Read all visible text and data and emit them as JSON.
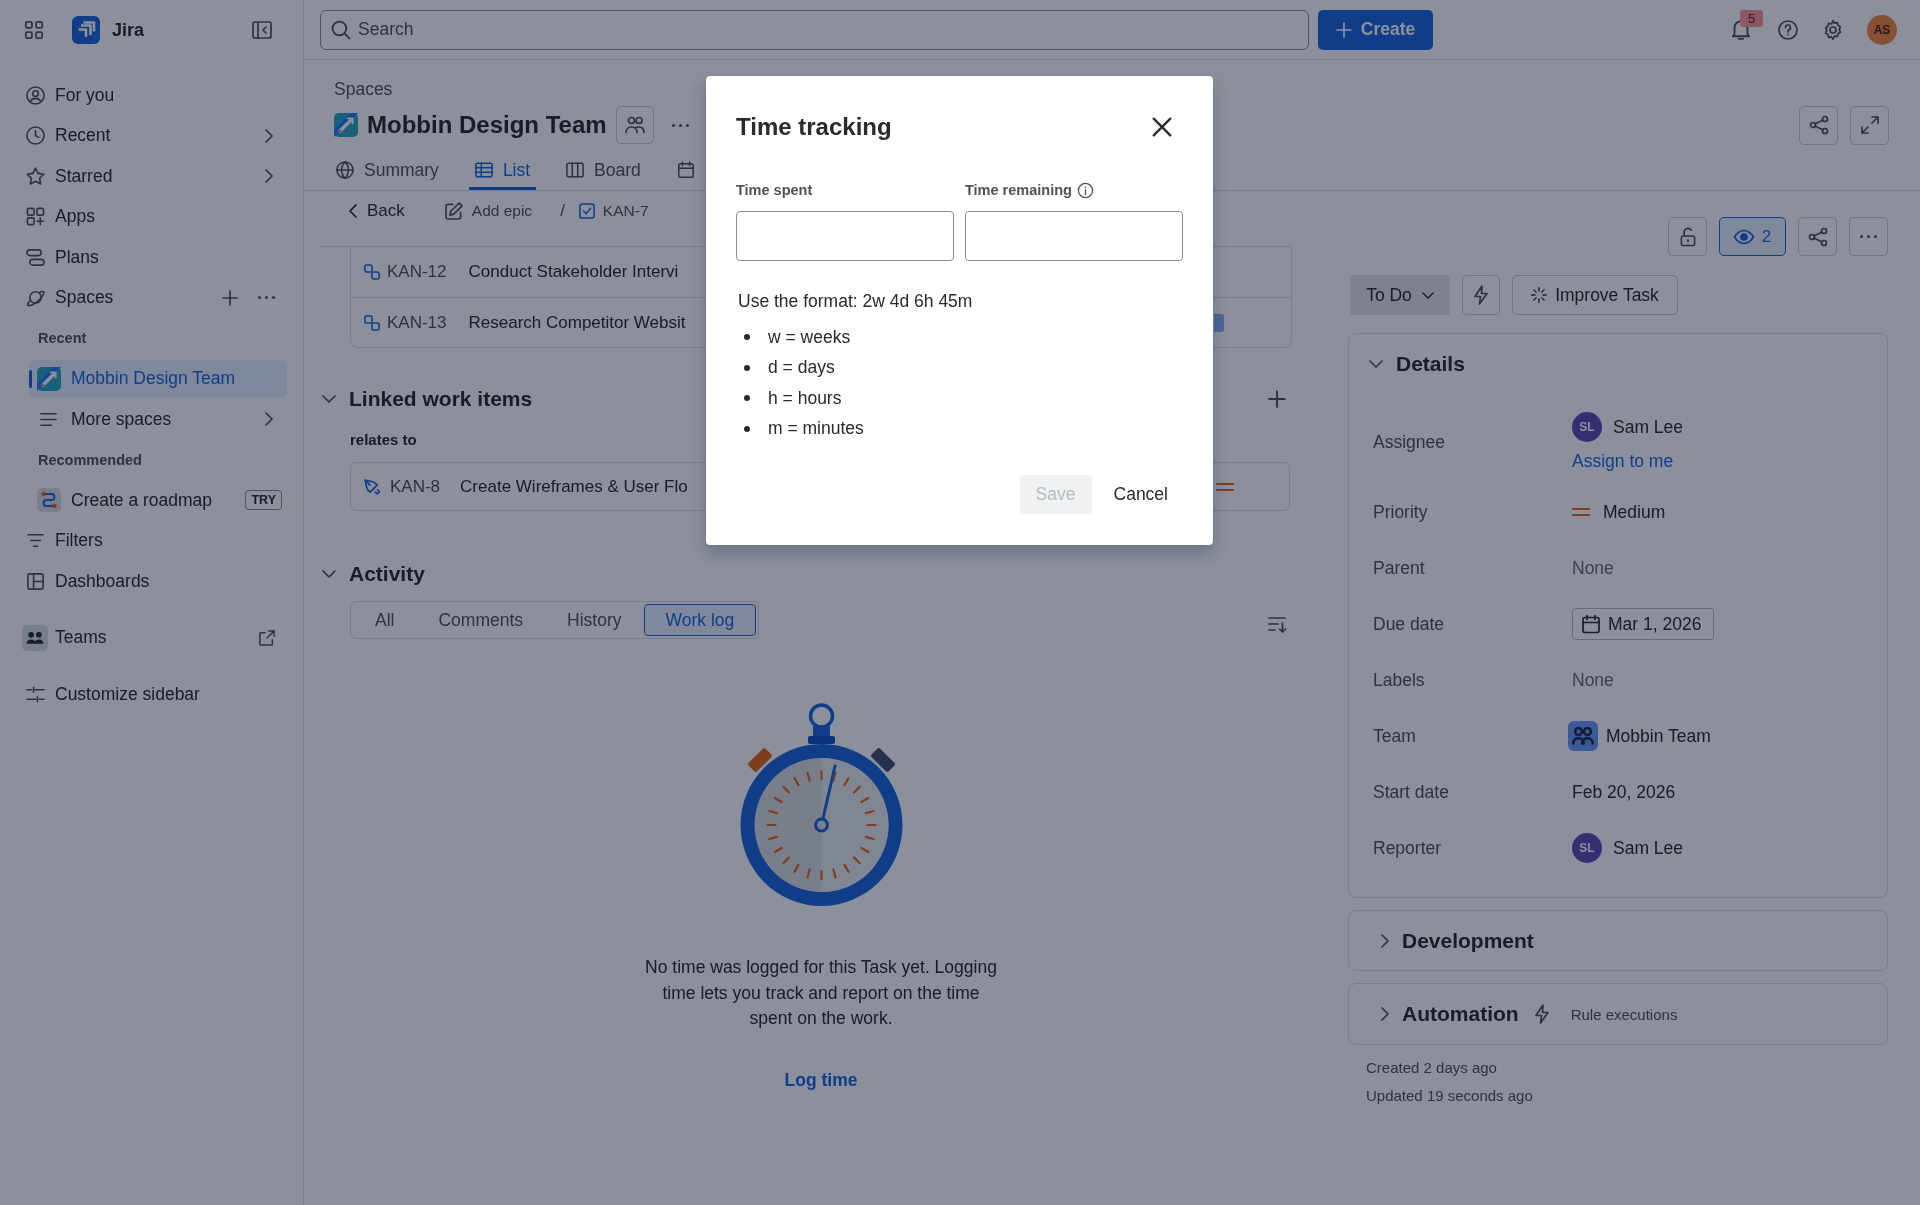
{
  "sidebar": {
    "app_name": "Jira",
    "items": [
      {
        "kind": "nav",
        "label": "For you",
        "selected": false,
        "chevron": false
      },
      {
        "kind": "nav",
        "label": "Recent",
        "selected": false,
        "chevron": true
      },
      {
        "kind": "nav",
        "label": "Starred",
        "selected": false,
        "chevron": true
      },
      {
        "kind": "nav",
        "label": "Apps",
        "selected": false,
        "chevron": false
      },
      {
        "kind": "nav",
        "label": "Plans",
        "selected": false,
        "chevron": false
      },
      {
        "kind": "section",
        "label": "Spaces",
        "selected": false,
        "chevron": false
      },
      {
        "kind": "heading",
        "label": "Recent"
      },
      {
        "kind": "space",
        "label": "Mobbin Design Team",
        "selected": true,
        "chevron": false
      },
      {
        "kind": "sub",
        "label": "More spaces",
        "selected": false,
        "chevron": true
      },
      {
        "kind": "heading",
        "label": "Recommended"
      },
      {
        "kind": "promo",
        "label": "Create a roadmap",
        "badge": "TRY",
        "selected": false,
        "chevron": false
      },
      {
        "kind": "nav",
        "label": "Filters",
        "selected": false,
        "chevron": false
      },
      {
        "kind": "nav",
        "label": "Dashboards",
        "selected": false,
        "chevron": false
      },
      {
        "kind": "external",
        "label": "Teams",
        "selected": false,
        "chevron": false
      },
      {
        "kind": "footer",
        "label": "Customize sidebar",
        "selected": false,
        "chevron": false
      }
    ]
  },
  "top_bar": {
    "search": {
      "placeholder": "Search"
    },
    "create_label": "Create",
    "notification_count": "5",
    "avatar_initials": "AS"
  },
  "space_header": {
    "breadcrumb": "Spaces",
    "title": "Mobbin Design Team",
    "tabs": [
      {
        "label": "Summary",
        "selected": false
      },
      {
        "label": "List",
        "selected": true
      },
      {
        "label": "Board",
        "selected": false
      },
      {
        "selected": false
      }
    ]
  },
  "work_item": {
    "toolbar": {
      "back": "Back",
      "add_epic": "Add epic",
      "separator": "/",
      "key": "KAN-7"
    },
    "child_items": [
      {
        "key": "KAN-12",
        "summary": "Conduct Stakeholder Intervi",
        "status_shown": false
      },
      {
        "key": "KAN-13",
        "summary": "Research Competitor Websit",
        "status_shown": true
      }
    ],
    "linked": {
      "title": "Linked work items",
      "expanded": true,
      "relation": "relates to",
      "items": [
        {
          "key": "KAN-8",
          "summary": "Create Wireframes & User Flo"
        }
      ]
    },
    "activity": {
      "title": "Activity",
      "expanded": true,
      "tabs": [
        {
          "label": "All",
          "selected": false
        },
        {
          "label": "Comments",
          "selected": false
        },
        {
          "label": "History",
          "selected": false
        },
        {
          "label": "Work log",
          "selected": true
        }
      ],
      "empty_message": "No time was logged for this Task yet. Logging time lets you track and report on the time spent on the work.",
      "action": "Log time"
    }
  },
  "right_panel": {
    "watchers": {
      "count": "2",
      "watching": true
    },
    "status": "To Do",
    "improve_label": "Improve Task",
    "details": {
      "title": "Details",
      "expanded": true,
      "fields": [
        {
          "label": "Assignee",
          "kind": "person",
          "initials": "SL",
          "value": "Sam Lee",
          "link": "Assign to me"
        },
        {
          "label": "Priority",
          "kind": "priority",
          "value": "Medium"
        },
        {
          "label": "Parent",
          "kind": "empty",
          "value": "None"
        },
        {
          "label": "Due date",
          "kind": "date",
          "value": "Mar 1, 2026"
        },
        {
          "label": "Labels",
          "kind": "empty",
          "value": "None"
        },
        {
          "label": "Team",
          "kind": "team",
          "value": "Mobbin Team"
        },
        {
          "label": "Start date",
          "kind": "text",
          "value": "Feb 20, 2026"
        },
        {
          "label": "Reporter",
          "kind": "person",
          "initials": "SL",
          "value": "Sam Lee"
        }
      ]
    },
    "sections": [
      {
        "kind": "development",
        "title": "Development",
        "expanded": false
      },
      {
        "kind": "automation",
        "title": "Automation",
        "expanded": false,
        "note": "Rule executions"
      }
    ],
    "timestamps": [
      "Created 2 days ago",
      "Updated 19 seconds ago"
    ]
  },
  "modal": {
    "title": "Time tracking",
    "fields": [
      {
        "label": "Time spent",
        "info": false
      },
      {
        "label": "Time remaining",
        "info": true
      }
    ],
    "hint": "Use the format: 2w 4d 6h 45m",
    "units": [
      "w = weeks",
      "d = days",
      "h = hours",
      "m = minutes"
    ],
    "buttons": [
      {
        "label": "Save",
        "kind": "primary",
        "disabled": true
      },
      {
        "label": "Cancel",
        "kind": "subtle",
        "disabled": false
      }
    ]
  }
}
